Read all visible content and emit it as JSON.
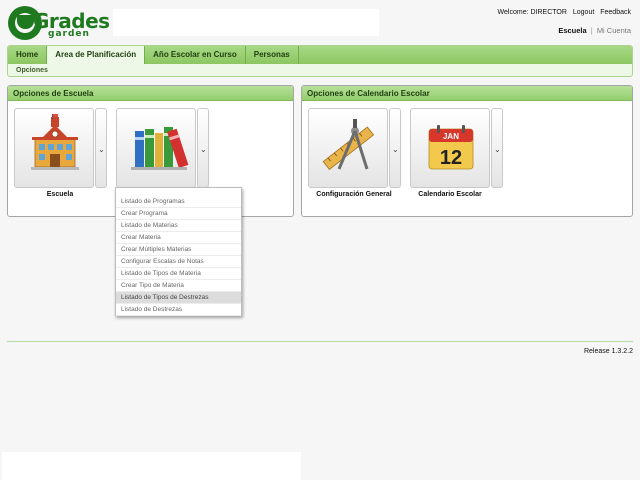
{
  "header": {
    "logo_text_main": "Grades",
    "logo_text_sub": "garden",
    "welcome": "Welcome: DIRECTOR",
    "logout": "Logout",
    "feedback": "Feedback",
    "account_current": "Escuela",
    "account_separator": "|",
    "account_other": "Mi Cuenta"
  },
  "nav": {
    "tabs": [
      {
        "label": "Home",
        "active": false
      },
      {
        "label": "Area de Planificación",
        "active": true
      },
      {
        "label": "Año Escolar en Curso",
        "active": false
      },
      {
        "label": "Personas",
        "active": false
      }
    ],
    "subnav": "Opciones"
  },
  "panels": {
    "school": {
      "title": "Opciones de Escuela",
      "tiles": [
        {
          "label": "Escuela",
          "icon": "school-building-icon"
        },
        {
          "label": "",
          "icon": "books-icon"
        }
      ]
    },
    "calendar": {
      "title": "Opciones de Calendario Escolar",
      "tiles": [
        {
          "label": "Configuración General",
          "icon": "drafting-tools-icon"
        },
        {
          "label": "Calendario Escolar",
          "icon": "calendar-icon"
        }
      ],
      "calendar_month": "JAN",
      "calendar_day": "12"
    }
  },
  "dropdown": {
    "items": [
      "Listado de Programas",
      "Crear Programa",
      "Listado de Materias",
      "Crear Materia",
      "Crear Múltiples Materias",
      "Configurar Escalas de Notas",
      "Listado de Tipos de Materia",
      "Crear Tipo de Materia",
      "Listado de Tipos de Destrezas",
      "Listado de Destrezas"
    ],
    "highlighted_index": 8
  },
  "footer": {
    "release": "Release 1.3.2.2"
  },
  "colors": {
    "brand_green": "#1f7a1f",
    "tab_bar": "#8cc661",
    "panel_head": "#93cd6c"
  }
}
